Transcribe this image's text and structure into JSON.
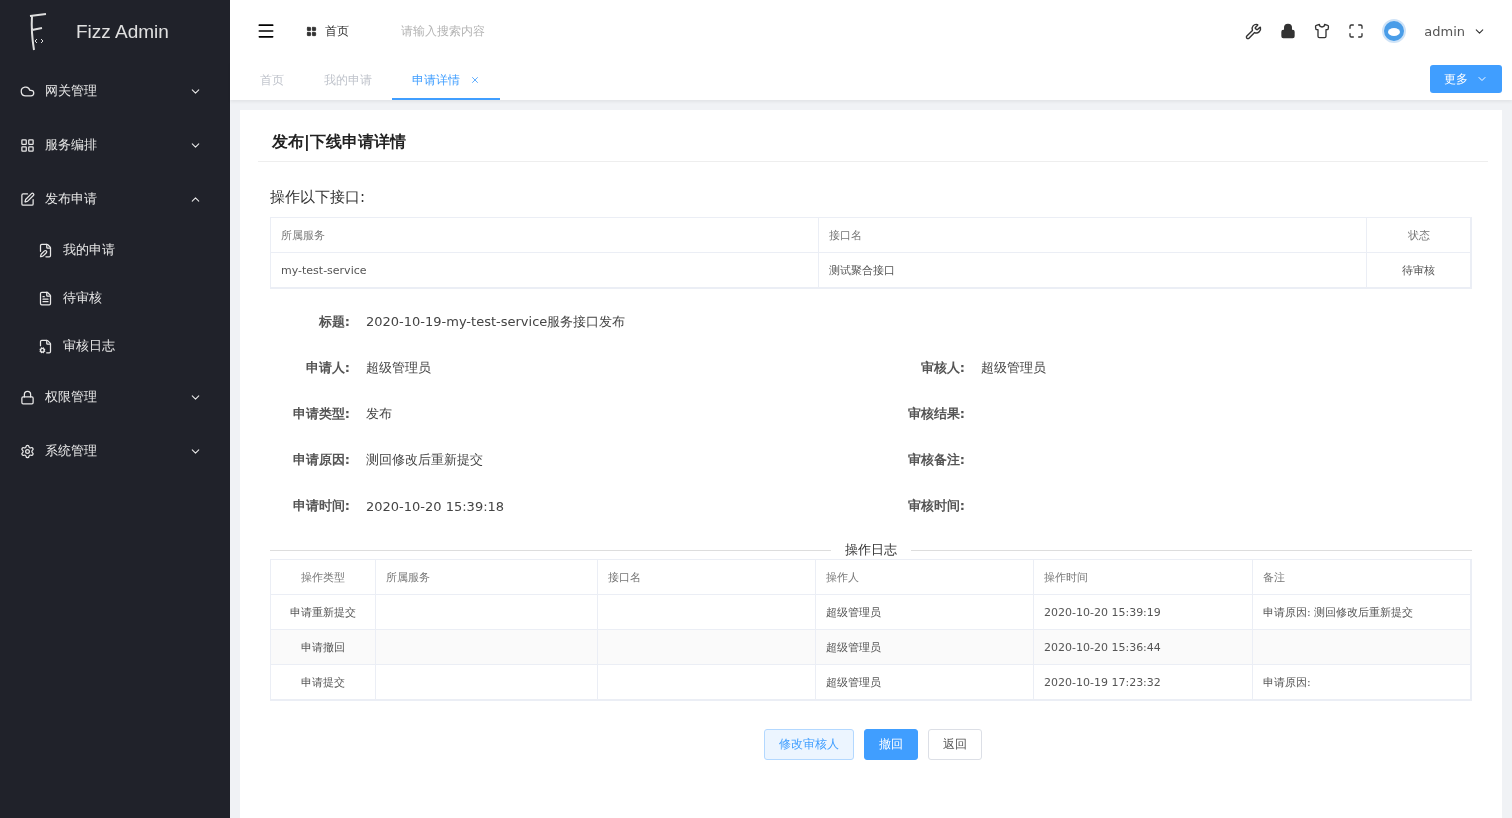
{
  "app": {
    "name": "Fizz Admin"
  },
  "sidebar": {
    "items": [
      {
        "label": "网关管理",
        "expanded": false
      },
      {
        "label": "服务编排",
        "expanded": false
      },
      {
        "label": "发布申请",
        "expanded": true,
        "children": [
          {
            "label": "我的申请"
          },
          {
            "label": "待审核"
          },
          {
            "label": "审核日志"
          }
        ]
      },
      {
        "label": "权限管理",
        "expanded": false
      },
      {
        "label": "系统管理",
        "expanded": false
      }
    ]
  },
  "header": {
    "breadcrumb": "首页",
    "search": {
      "placeholder": "请输入搜索内容"
    },
    "user": "admin"
  },
  "tabs": [
    {
      "label": "首页",
      "selected": false
    },
    {
      "label": "我的申请",
      "selected": false
    },
    {
      "label": "申请详情",
      "selected": true,
      "closable": true
    }
  ],
  "more_button": "更多",
  "page_title": "发布|下线申请详情",
  "interfaces": {
    "heading": "操作以下接口:",
    "columns": [
      "所属服务",
      "接口名",
      "状态"
    ],
    "rows": [
      [
        "my-test-service",
        "测试聚合接口",
        "待审核"
      ]
    ]
  },
  "details": [
    {
      "left": {
        "label": "标题:",
        "value": "2020-10-19-my-test-service服务接口发布"
      }
    },
    {
      "left": {
        "label": "申请人:",
        "value": "超级管理员"
      },
      "right": {
        "label": "审核人:",
        "value": "超级管理员"
      }
    },
    {
      "left": {
        "label": "申请类型:",
        "value": "发布"
      },
      "right": {
        "label": "审核结果:"
      }
    },
    {
      "left": {
        "label": "申请原因:",
        "value": "测回修改后重新提交"
      },
      "right": {
        "label": "审核备注:"
      }
    },
    {
      "left": {
        "label": "申请时间:",
        "value": "2020-10-20 15:39:18"
      },
      "right": {
        "label": "审核时间:"
      }
    }
  ],
  "log": {
    "heading": "操作日志",
    "columns": [
      "操作类型",
      "所属服务",
      "接口名",
      "操作人",
      "操作时间",
      "备注"
    ],
    "rows": [
      [
        "申请重新提交",
        "",
        "",
        "超级管理员",
        "2020-10-20 15:39:19",
        "申请原因: 测回修改后重新提交"
      ],
      [
        "申请撤回",
        "",
        "",
        "超级管理员",
        "2020-10-20 15:36:44",
        ""
      ],
      [
        "申请提交",
        "",
        "",
        "超级管理员",
        "2020-10-19 17:23:32",
        "申请原因:"
      ]
    ]
  },
  "buttons": [
    {
      "label": "修改审核人",
      "kind": "plain-primary"
    },
    {
      "label": "撤回",
      "kind": "primary"
    },
    {
      "label": "返回",
      "kind": "default"
    }
  ]
}
